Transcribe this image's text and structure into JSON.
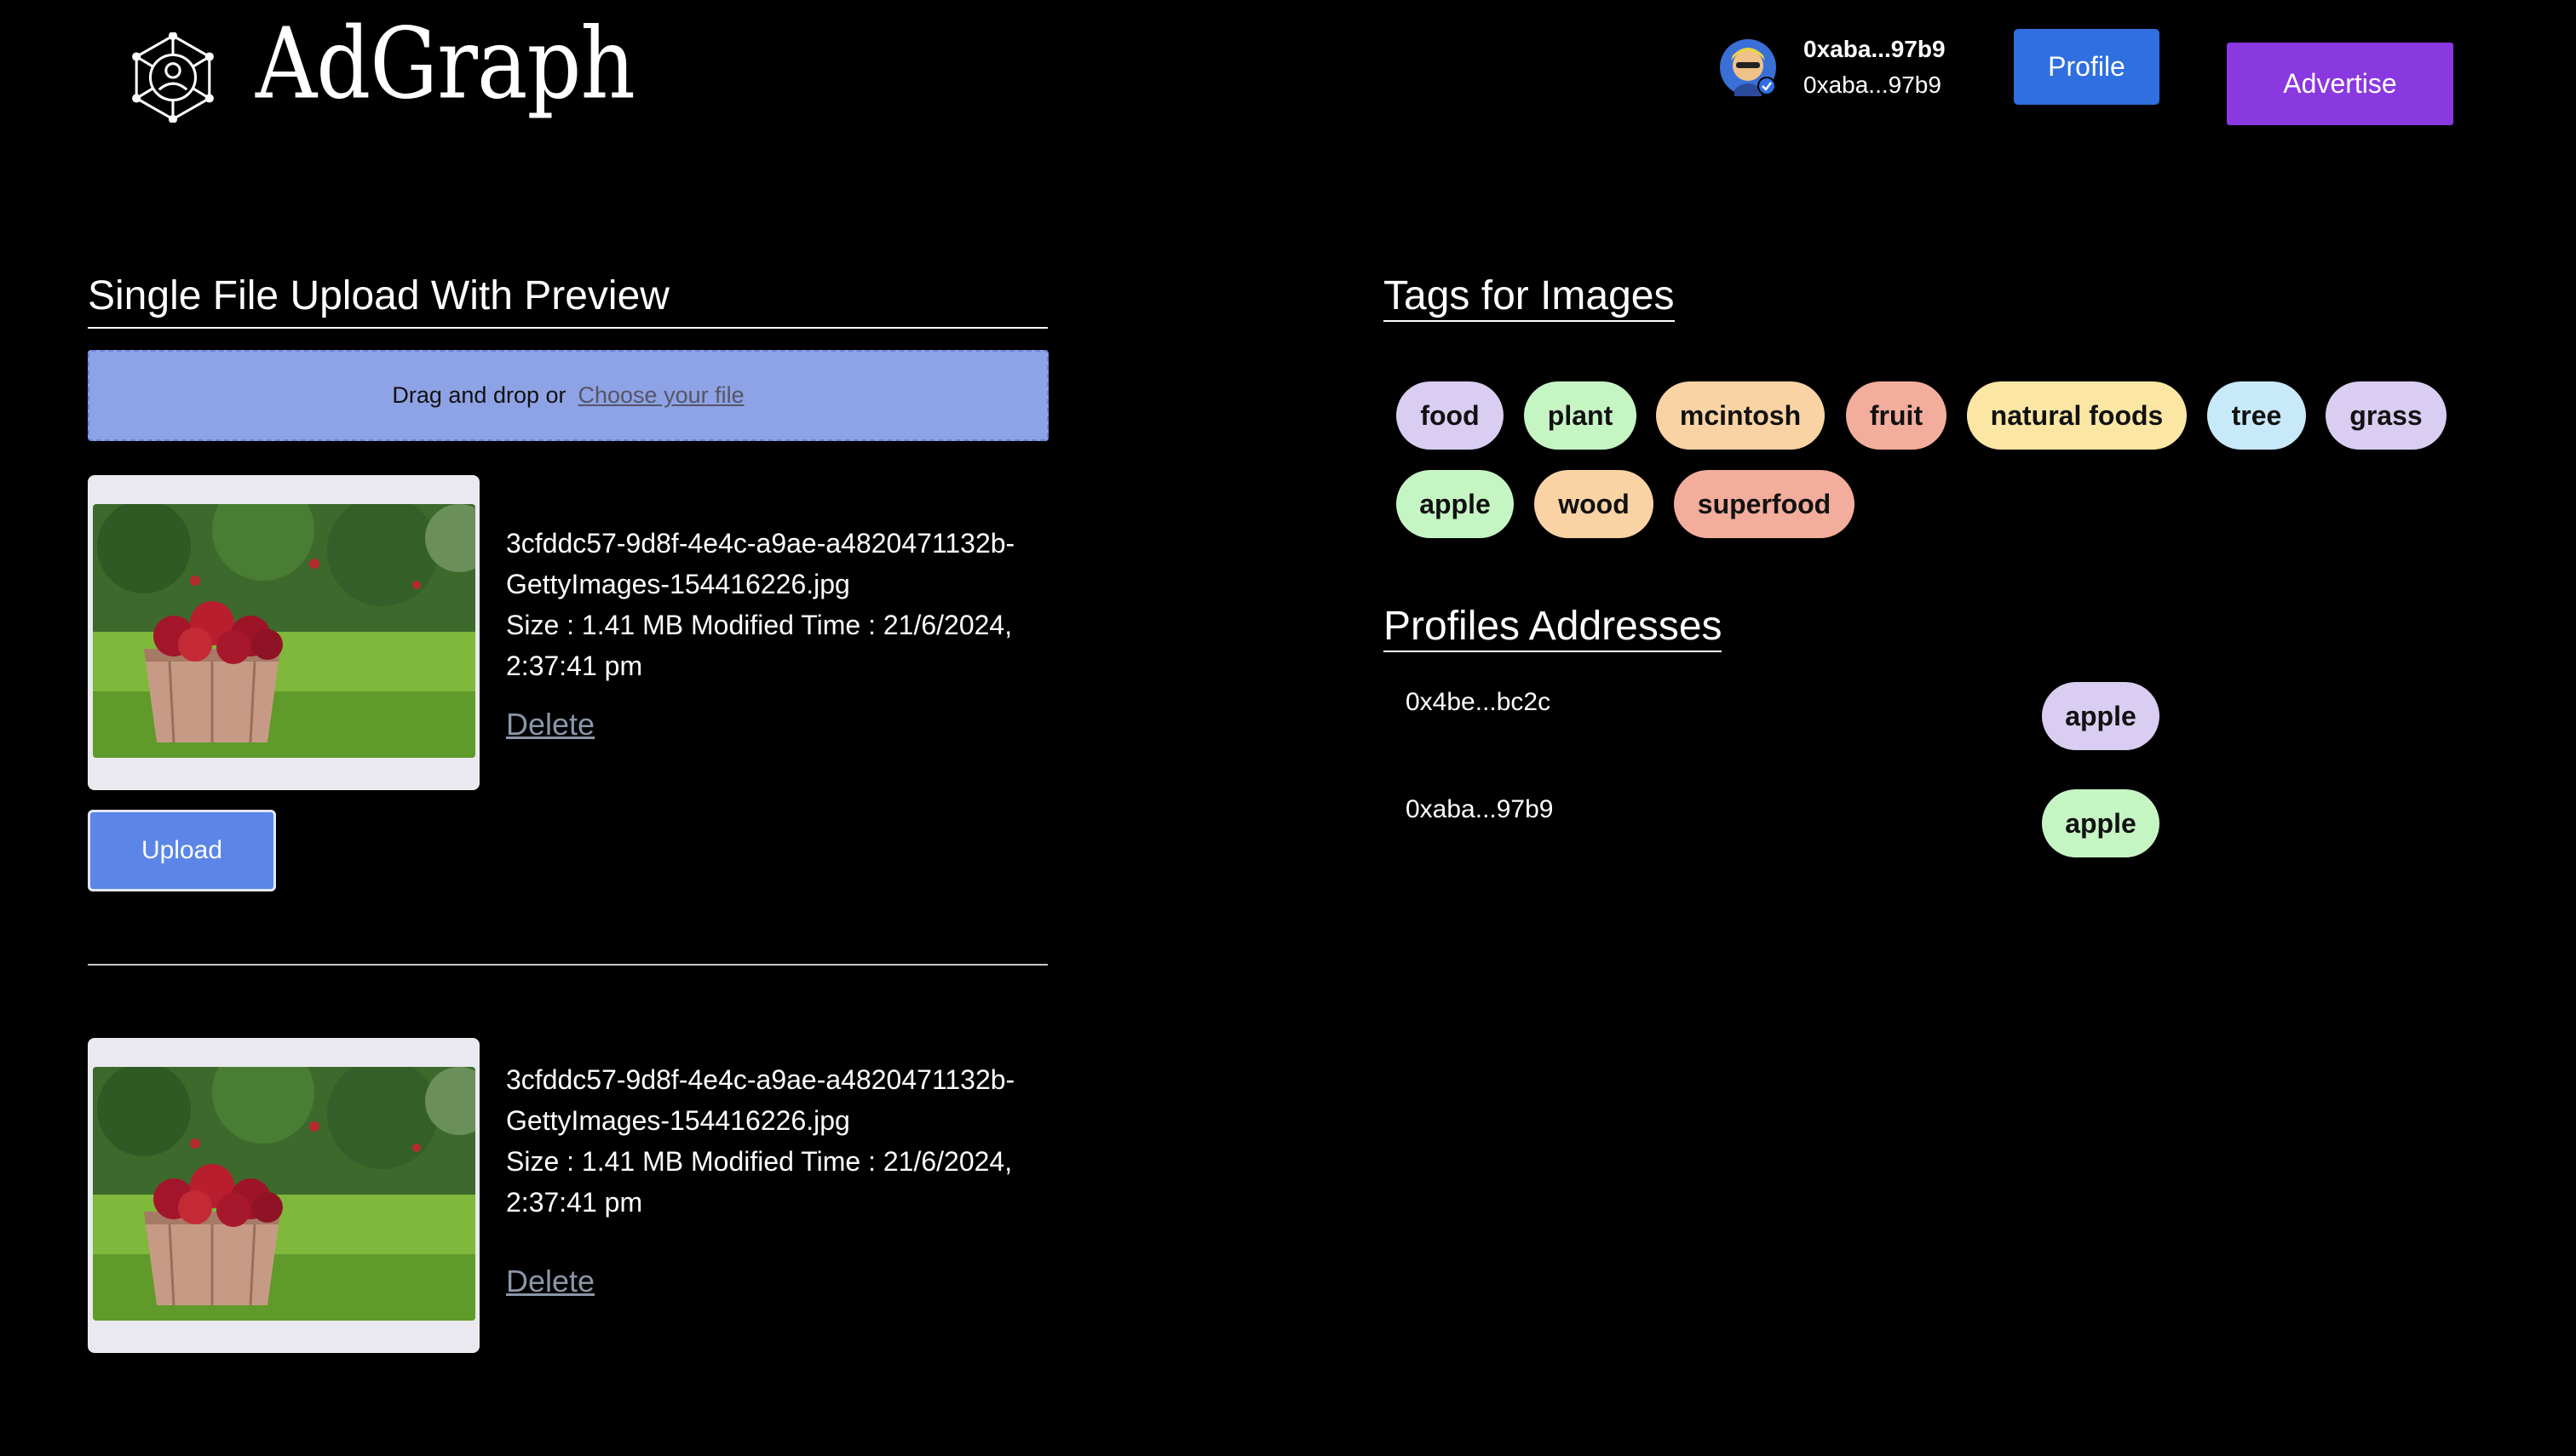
{
  "header": {
    "brand": "AdGraph",
    "wallet_name": "0xaba...97b9",
    "wallet_address": "0xaba...97b9",
    "profile_label": "Profile",
    "advertise_label": "Advertise"
  },
  "upload": {
    "title": "Single File Upload With Preview",
    "drop_text": "Drag and drop or",
    "choose_link": "Choose your file",
    "file_name_1": "3cfddc57-9d8f-4e4c-a9ae-a4820471132b-",
    "file_name_2": "GettyImages-154416226.jpg",
    "meta_1": "Size : 1.41 MB  Modified Time : 21/6/2024,",
    "meta_2": "2:37:41 pm",
    "delete_label": "Delete",
    "upload_label": "Upload"
  },
  "uploaded": {
    "file_name_1": "3cfddc57-9d8f-4e4c-a9ae-a4820471132b-",
    "file_name_2": "GettyImages-154416226.jpg",
    "meta_1": "Size : 1.41 MB   Modified Time : 21/6/2024,",
    "meta_2": "2:37:41 pm",
    "delete_label": "Delete"
  },
  "tags": {
    "title": "Tags for Images",
    "items": [
      {
        "label": "food",
        "color": "#d9cdf2"
      },
      {
        "label": "plant",
        "color": "#c6f5c4"
      },
      {
        "label": "mcintosh",
        "color": "#f9d3a3"
      },
      {
        "label": "fruit",
        "color": "#f3ad9c"
      },
      {
        "label": "natural foods",
        "color": "#fbe6a4"
      },
      {
        "label": "tree",
        "color": "#c8e9f9"
      },
      {
        "label": "grass",
        "color": "#d9cdf2"
      },
      {
        "label": "apple",
        "color": "#c6f5c4"
      },
      {
        "label": "wood",
        "color": "#f9d3a3"
      },
      {
        "label": "superfood",
        "color": "#f3ad9c"
      }
    ]
  },
  "profiles": {
    "title": "Profiles Addresses",
    "rows": [
      {
        "address": "0x4be...bc2c",
        "tag": "apple",
        "color": "#d9cdf2"
      },
      {
        "address": "0xaba...97b9",
        "tag": "apple",
        "color": "#c6f5c4"
      }
    ]
  },
  "icons": {
    "logo": "network-user-icon",
    "verified": "check-badge-icon"
  }
}
